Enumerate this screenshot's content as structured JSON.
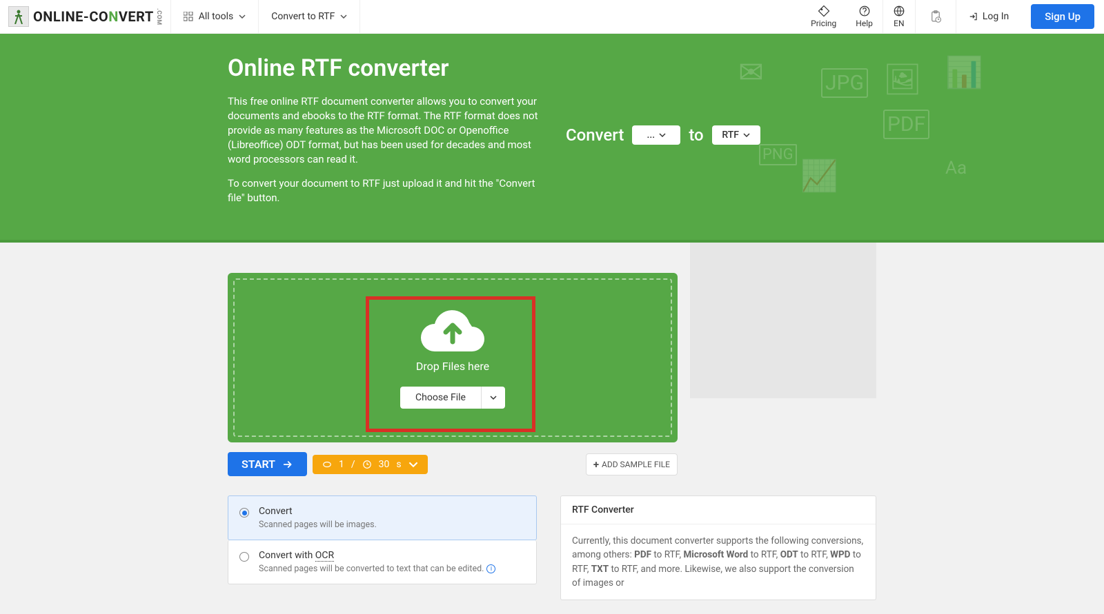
{
  "nav": {
    "logo_brand_1": "ONLINE-",
    "logo_brand_2": "CO",
    "logo_brand_3": "N",
    "logo_brand_4": "VERT",
    "logo_com": ".COM",
    "all_tools": "All tools",
    "convert_to": "Convert to RTF",
    "pricing": "Pricing",
    "help": "Help",
    "lang": "EN",
    "login": "Log In",
    "signup": "Sign Up"
  },
  "hero": {
    "title": "Online RTF converter",
    "p1": "This free online RTF document converter allows you to convert your documents and ebooks to the RTF format. The RTF format does not provide as many features as the Microsoft DOC or Openoffice (Libreoffice) ODT format, but has been used for decades and most word processors can read it.",
    "p2": "To convert your document to RTF just upload it and hit the \"Convert file\" button.",
    "convert_label": "Convert",
    "from_value": "...",
    "to_label": "to",
    "to_value": "RTF"
  },
  "drop": {
    "text": "Drop Files here",
    "choose": "Choose File"
  },
  "actions": {
    "start": "START",
    "count": "1",
    "sep": "/",
    "time": "30",
    "unit": "s",
    "add_sample": "ADD SAMPLE FILE"
  },
  "options": {
    "opt1_title": "Convert",
    "opt1_sub": "Scanned pages will be images.",
    "opt2_title": "Convert with OCR",
    "opt2_sub": "Scanned pages will be converted to text that can be edited."
  },
  "info": {
    "header": "RTF Converter",
    "body_prefix": "Currently, this document converter supports the following conversions, among others: ",
    "b1": "PDF",
    "t1": " to RTF, ",
    "b2": "Microsoft Word",
    "t2": " to RTF, ",
    "b3": "ODT",
    "t3": " to RTF, ",
    "b4": "WPD",
    "t4": " to RTF, ",
    "b5": "TXT",
    "t5": " to RTF, and more. Likewise, we also support the conversion of images or"
  }
}
